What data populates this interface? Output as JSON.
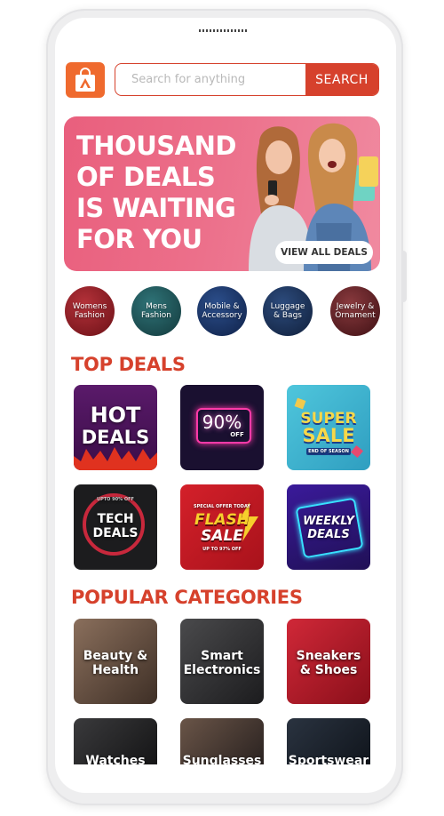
{
  "header": {
    "search_placeholder": "Search for anything",
    "search_button": "SEARCH"
  },
  "banner": {
    "title_lines": [
      "THOUSAND",
      "OF DEALS",
      "IS WAITING",
      "FOR YOU"
    ],
    "cta": "VIEW ALL DEALS"
  },
  "categories_row": [
    {
      "line1": "Womens",
      "line2": "Fashion"
    },
    {
      "line1": "Mens",
      "line2": "Fashion"
    },
    {
      "line1": "Mobile &",
      "line2": "Accessory"
    },
    {
      "line1": "Luggage",
      "line2": "& Bags"
    },
    {
      "line1": "Jewelry &",
      "line2": "Ornament"
    }
  ],
  "top_deals": {
    "title": "TOP DEALS",
    "tiles": [
      {
        "line1": "HOT",
        "line2": "DEALS"
      },
      {
        "main": "90%",
        "sub": "OFF"
      },
      {
        "line1": "SUPER",
        "line2": "SALE",
        "sub": "END OF SEASON"
      },
      {
        "top": "UPTO 90% OFF",
        "line1": "TECH",
        "line2": "DEALS"
      },
      {
        "top": "SPECIAL OFFER TODAY",
        "line1": "FLASH",
        "line2": "SALE",
        "sub": "UP TO 97% OFF"
      },
      {
        "line1": "WEEKLY",
        "line2": "DEALS"
      }
    ]
  },
  "popular": {
    "title": "POPULAR CATEGORIES",
    "tiles": [
      {
        "line1": "Beauty &",
        "line2": "Health"
      },
      {
        "line1": "Smart",
        "line2": "Electronics"
      },
      {
        "line1": "Sneakers",
        "line2": "& Shoes"
      },
      {
        "line1": "Watches",
        "line2": ""
      },
      {
        "line1": "Sunglasses",
        "line2": ""
      },
      {
        "line1": "Sportswear",
        "line2": ""
      }
    ]
  },
  "colors": {
    "accent": "#d6412c",
    "logo": "#ef6a2e",
    "banner": "#ec6f8a"
  }
}
